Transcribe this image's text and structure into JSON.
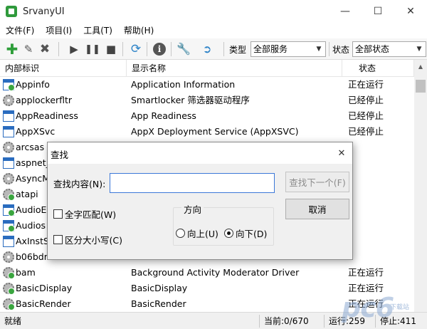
{
  "window": {
    "title": "SrvanyUI"
  },
  "menu": [
    "文件(F)",
    "项目(I)",
    "工具(T)",
    "帮助(H)"
  ],
  "toolbar": {
    "type_label": "类型",
    "type_value": "全部服务",
    "status_label": "状态",
    "status_value": "全部状态",
    "icons": [
      "add-icon",
      "edit-icon",
      "delete-icon",
      "play-icon",
      "pause-icon",
      "stop-icon",
      "refresh-icon",
      "info-icon",
      "wrench-icon",
      "exit-icon"
    ],
    "colors": {
      "add": "#2e9e3a",
      "delete": "#555555",
      "refresh": "#2e84c8",
      "info": "#555555"
    }
  },
  "list": {
    "columns": [
      "内部标识",
      "显示名称",
      "状态"
    ],
    "rows": [
      {
        "id": "Appinfo",
        "name": "Application Information",
        "status": "正在运行",
        "icon": "win-run"
      },
      {
        "id": "applockerfltr",
        "name": "Smartlocker 筛选器驱动程序",
        "status": "已经停止",
        "icon": "gear"
      },
      {
        "id": "AppReadiness",
        "name": "App Readiness",
        "status": "已经停止",
        "icon": "win"
      },
      {
        "id": "AppXSvc",
        "name": "AppX Deployment Service (AppXSVC)",
        "status": "已经停止",
        "icon": "win"
      },
      {
        "id": "arcsas",
        "name": "",
        "status": "",
        "icon": "gear"
      },
      {
        "id": "aspnet_",
        "name": "",
        "status": "",
        "icon": "win"
      },
      {
        "id": "AsyncM",
        "name": "",
        "status": "",
        "icon": "gear"
      },
      {
        "id": "atapi",
        "name": "",
        "status": "",
        "icon": "gear-run"
      },
      {
        "id": "AudioE",
        "name": "",
        "status": "",
        "icon": "win-run"
      },
      {
        "id": "Audios",
        "name": "",
        "status": "",
        "icon": "win-run"
      },
      {
        "id": "AxInstS",
        "name": "",
        "status": "",
        "icon": "win"
      },
      {
        "id": "b06bdr",
        "name": "",
        "status": "",
        "icon": "gear"
      },
      {
        "id": "bam",
        "name": "Background Activity Moderator Driver",
        "status": "正在运行",
        "icon": "gear-run"
      },
      {
        "id": "BasicDisplay",
        "name": "BasicDisplay",
        "status": "正在运行",
        "icon": "gear-run"
      },
      {
        "id": "BasicRender",
        "name": "BasicRender",
        "status": "正在运行",
        "icon": "gear-run"
      }
    ]
  },
  "statusbar": {
    "ready": "就绪",
    "current": "当前:0/670",
    "running": "运行:259",
    "stopped": "停止:411"
  },
  "find_dialog": {
    "title": "查找",
    "find_label": "查找内容(N):",
    "find_value": "",
    "find_next": "查找下一个(F)",
    "cancel": "取消",
    "whole_word": "全字匹配(W)",
    "match_case": "区分大小写(C)",
    "direction": "方向",
    "up": "向上(U)",
    "down": "向下(D)",
    "direction_selected": "down"
  },
  "watermark": {
    "text": "pc6",
    "sub": "下载站"
  }
}
